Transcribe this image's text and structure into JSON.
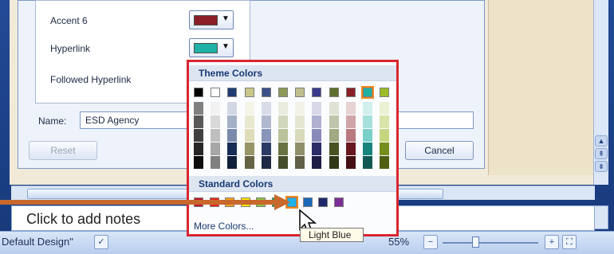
{
  "dialog": {
    "rows": [
      {
        "label": "Accent 6",
        "color": "#8a1f28"
      },
      {
        "label": "Hyperlink",
        "color": "#1fb1a5"
      },
      {
        "label": "Followed Hyperlink"
      }
    ],
    "name_label": "Name:",
    "name_value": "ESD Agency",
    "reset_label": "Reset",
    "cancel_label": "Cancel"
  },
  "palette": {
    "theme_header": "Theme Colors",
    "standard_header": "Standard Colors",
    "more_colors": "More Colors...",
    "theme_base": [
      "#000000",
      "#ffffff",
      "#1f3b73",
      "#c9c68a",
      "#3b4f88",
      "#8c9a58",
      "#bfc08e",
      "#3a3a8c",
      "#5f6f2e",
      "#8a1f28",
      "#1fb1a5",
      "#9cbd28"
    ],
    "standard": [
      "#c0172a",
      "#e8251c",
      "#f7a11a",
      "#fde800",
      "#8ac43f",
      "#1ea14a",
      "#1fb1e9",
      "#1969b8",
      "#1e2a6b",
      "#7b2f97"
    ],
    "selected_standard_index": 6
  },
  "tooltip": "Light Blue",
  "notes_placeholder": "Click to add notes",
  "status": {
    "design": "Default Design\"",
    "zoom": "55%"
  },
  "icons": {
    "check": "check-icon",
    "zoom_out": "minus-icon",
    "zoom_in": "plus-icon",
    "fit": "fit-icon"
  }
}
